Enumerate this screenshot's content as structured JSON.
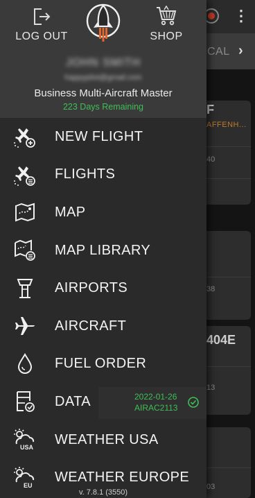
{
  "header": {
    "logout_label": "LOG OUT",
    "shop_label": "SHOP",
    "user_name": "JOHN SMITH",
    "user_email": "happypilot@gmail.com",
    "plan": "Business Multi-Aircraft Master",
    "days_remaining": "223 Days Remaining"
  },
  "menu": [
    {
      "label": "NEW FLIGHT",
      "icon": "new-flight-icon"
    },
    {
      "label": "FLIGHTS",
      "icon": "flights-icon"
    },
    {
      "label": "MAP",
      "icon": "map-icon"
    },
    {
      "label": "MAP LIBRARY",
      "icon": "map-library-icon"
    },
    {
      "label": "AIRPORTS",
      "icon": "airport-tower-icon"
    },
    {
      "label": "AIRCRAFT",
      "icon": "airplane-icon"
    },
    {
      "label": "FUEL ORDER",
      "icon": "fuel-drop-icon"
    },
    {
      "label": "DATA",
      "icon": "data-icon"
    },
    {
      "label": "WEATHER USA",
      "icon": "weather-usa-icon"
    },
    {
      "label": "WEATHER EUROPE",
      "icon": "weather-eu-icon"
    }
  ],
  "data_status": {
    "date": "2022-01-26",
    "cycle": "AIRAC2113"
  },
  "version": "v. 7.8.1 (3550)",
  "background": {
    "tab_label": "RICAL",
    "card1_title": "F",
    "card1_subtitle": "AFFENH...",
    "card1_value": "40",
    "card2_value": "38",
    "card3_title": "404E",
    "card3_value": "13",
    "card4_value": "03"
  },
  "colors": {
    "accent_green": "#3fbf57",
    "logo_orange": "#e2672d",
    "drawer_bg": "#2a2a2a",
    "header_bg": "#3a3a3a"
  }
}
